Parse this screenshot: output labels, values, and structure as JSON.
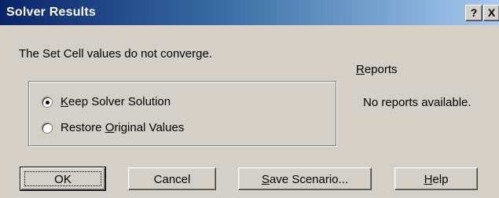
{
  "window": {
    "title": "Solver Results",
    "help_button": "?",
    "close_button": "X"
  },
  "message": "The Set Cell values do not converge.",
  "options": [
    {
      "prefix": "",
      "accel": "K",
      "rest": "eep Solver Solution",
      "selected": true
    },
    {
      "prefix": "Restore ",
      "accel": "O",
      "rest": "riginal Values",
      "selected": false
    }
  ],
  "reports": {
    "label_accel": "R",
    "label_rest": "eports",
    "list_text": "No reports available."
  },
  "buttons": {
    "ok": "OK",
    "cancel": "Cancel",
    "save_scenario_accel": "S",
    "save_scenario_rest": "ave Scenario...",
    "help_accel": "H",
    "help_rest": "elp"
  }
}
